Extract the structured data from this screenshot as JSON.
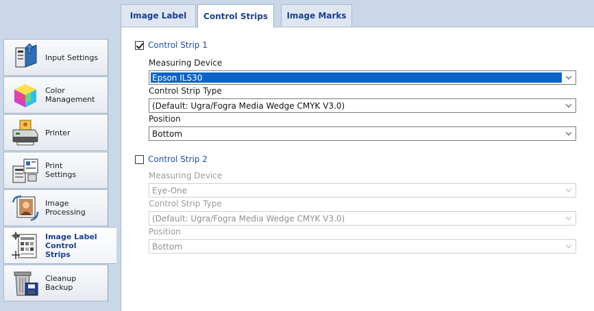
{
  "nav": {
    "items": [
      {
        "label": "Input Settings",
        "icon": "input-settings-icon"
      },
      {
        "label": "Color\nManagement",
        "icon": "color-cube-icon"
      },
      {
        "label": "Printer",
        "icon": "printer-icon"
      },
      {
        "label": "Print\nSettings",
        "icon": "print-settings-icon"
      },
      {
        "label": "Image\nProcessing",
        "icon": "image-processing-icon"
      },
      {
        "label": "Image Label\nControl\nStrips",
        "icon": "control-strips-icon",
        "active": true
      },
      {
        "label": "Cleanup\nBackup",
        "icon": "cleanup-backup-icon"
      }
    ]
  },
  "tabs": [
    {
      "label": "Image Label"
    },
    {
      "label": "Control Strips",
      "active": true
    },
    {
      "label": "Image Marks"
    }
  ],
  "strip1": {
    "label": "Control Strip 1",
    "checked": true,
    "measuring_device_label": "Measuring Device",
    "measuring_device_value": "Epson ILS30",
    "type_label": "Control Strip Type",
    "type_value": "(Default: Ugra/Fogra Media Wedge CMYK V3.0)",
    "position_label": "Position",
    "position_value": "Bottom"
  },
  "strip2": {
    "label": "Control Strip 2",
    "checked": false,
    "measuring_device_label": "Measuring Device",
    "measuring_device_value": "Eye-One",
    "type_label": "Control Strip Type",
    "type_value": "(Default: Ugra/Fogra Media Wedge CMYK V3.0)",
    "position_label": "Position",
    "position_value": "Bottom"
  },
  "colors": {
    "accent": "#1a3f8f",
    "link": "#1f4fa3",
    "selection": "#0a64c8",
    "background": "#c9d7e8"
  }
}
